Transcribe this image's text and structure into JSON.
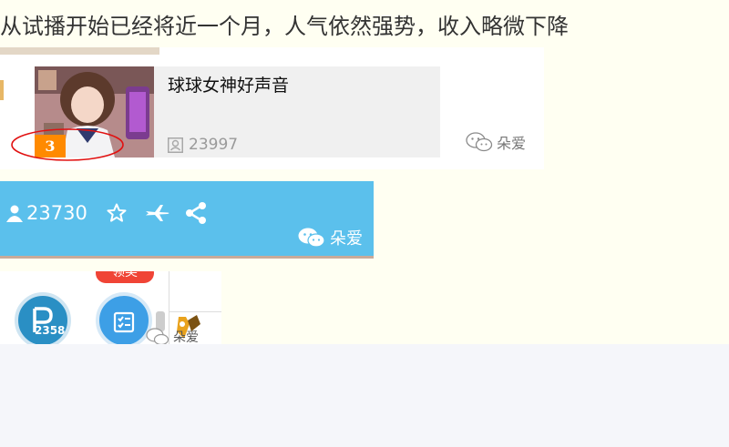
{
  "headline": "从试播开始已经将近一个月，人气依然强势，收入略微下降",
  "card": {
    "title": "球球女神好声音",
    "viewer_count": "23997",
    "rank": "3"
  },
  "bar": {
    "viewer_count": "23730"
  },
  "panel": {
    "parking_count": "2358",
    "claim_badge": "领奖"
  },
  "watermark": "朵爱",
  "icons": {
    "viewer": "user-icon",
    "favorite": "star-icon",
    "send": "plane-icon",
    "share": "share-icon",
    "parking": "parking-icon",
    "task": "task-list-icon",
    "trophy": "trophy-icon",
    "watermark": "wechat-icon"
  },
  "colors": {
    "page_background": "#fffff2",
    "bar_background": "#5bc0ec",
    "rank_badge": "#ff8a00",
    "highlight_circle": "#e11111",
    "claim_badge": "#f04436",
    "parking_button": "#2a8fc4",
    "task_button": "#3d9fe6"
  }
}
